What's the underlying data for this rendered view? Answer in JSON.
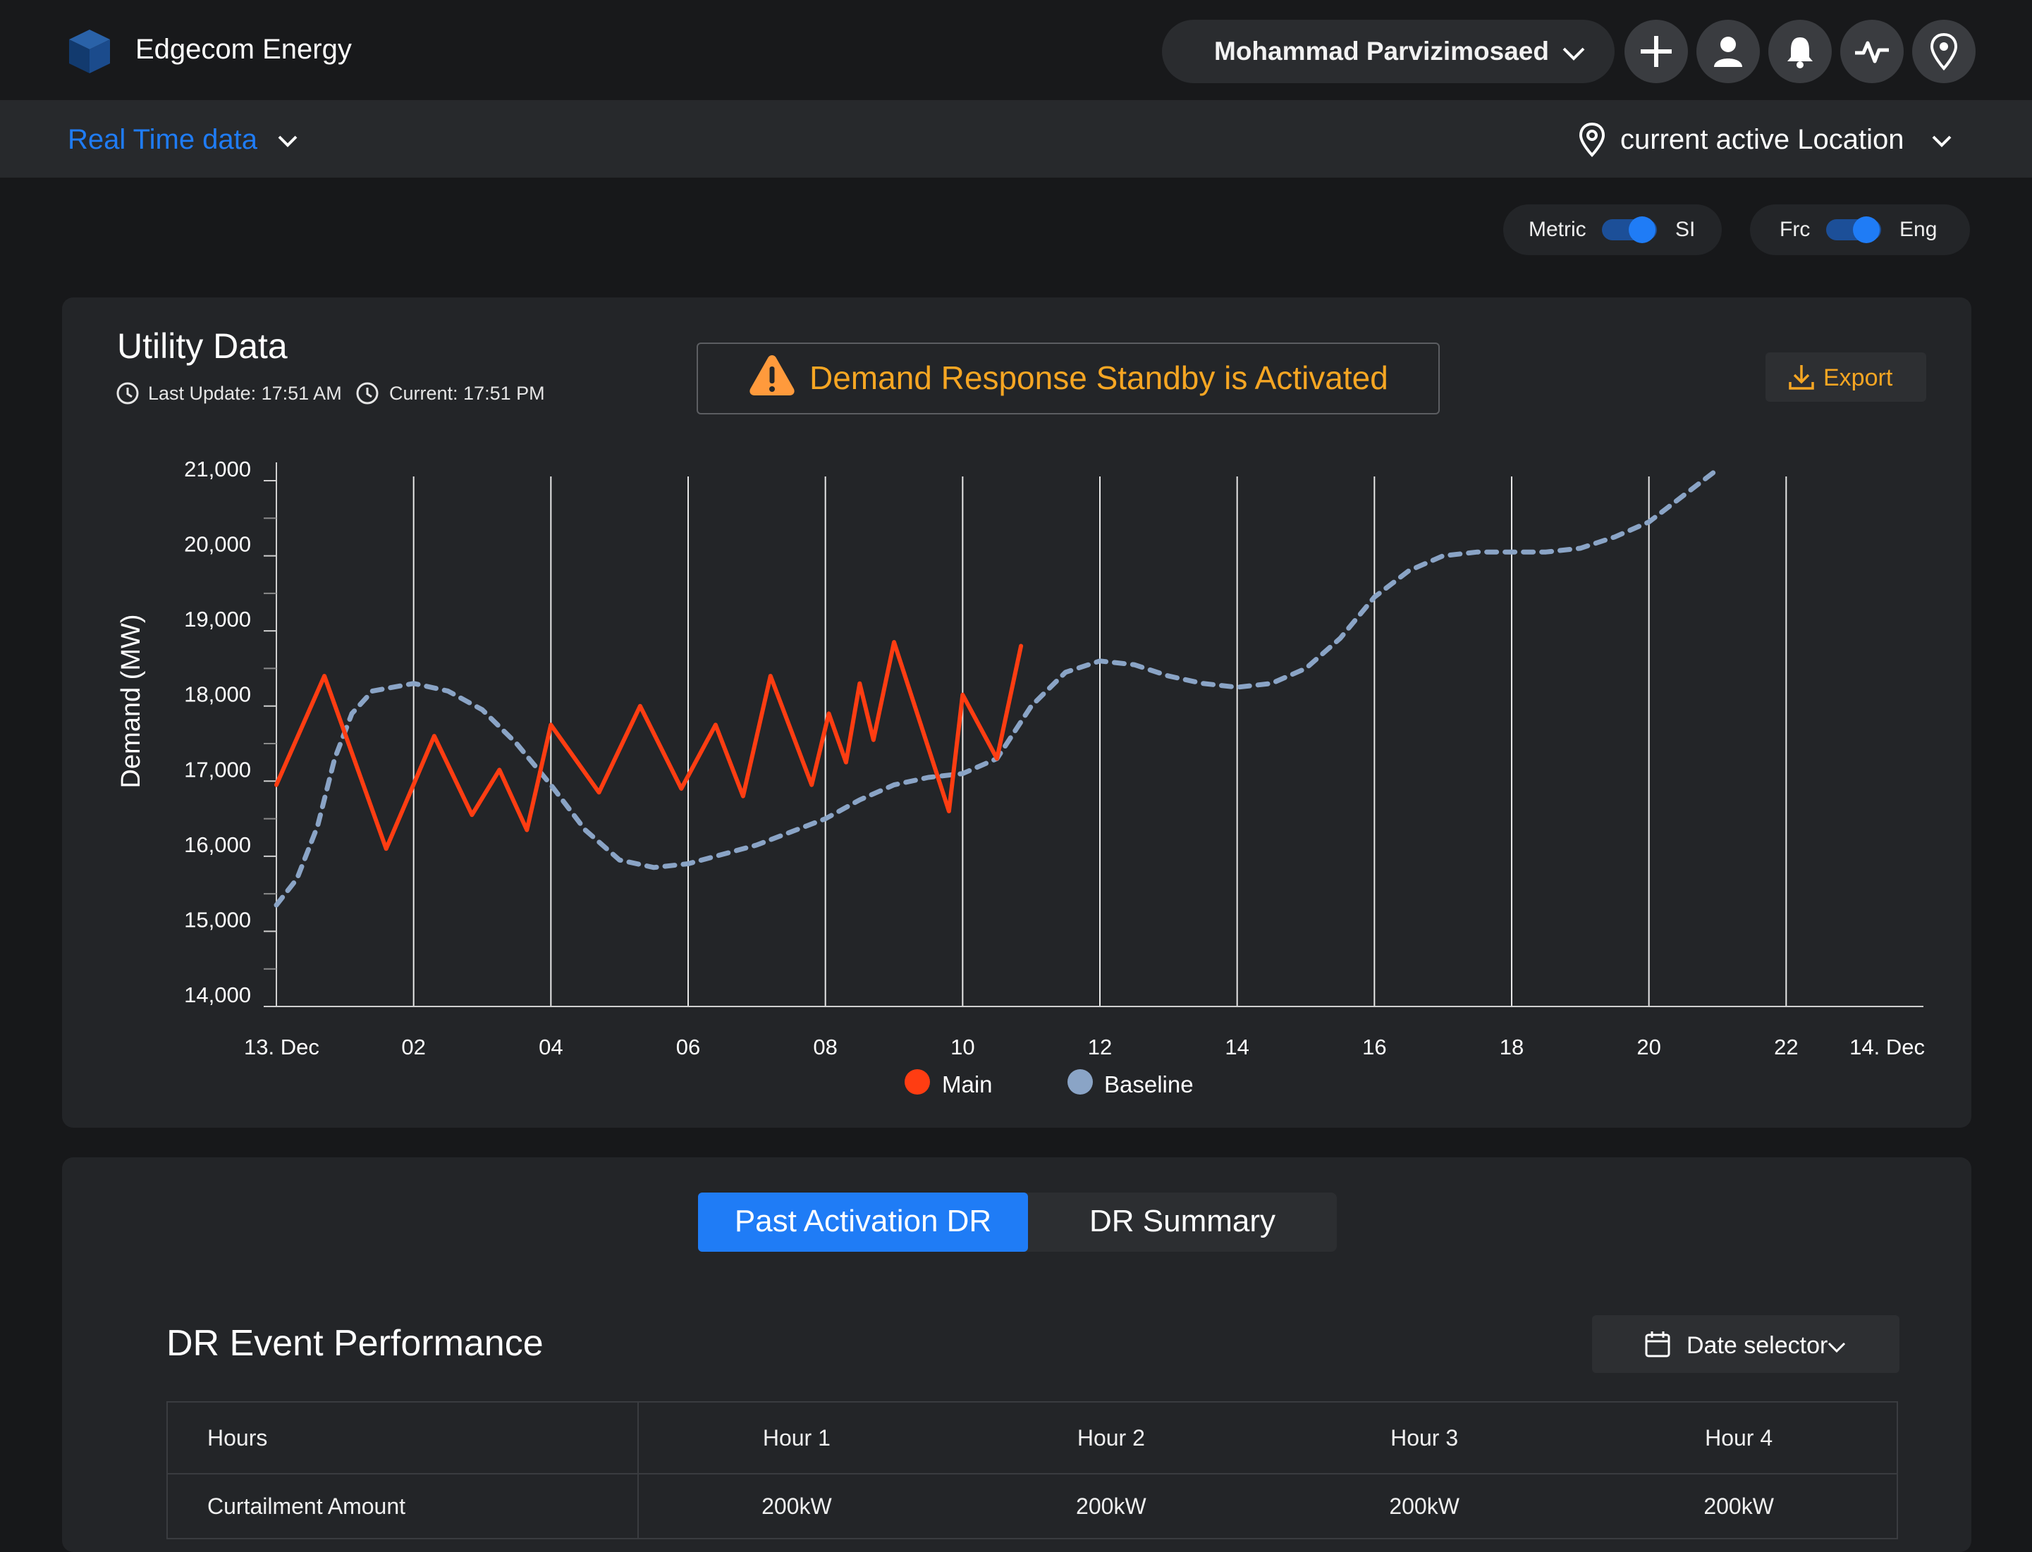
{
  "header": {
    "brand": "Edgecom Energy",
    "user_name": "Mohammad Parvizimosaed",
    "icons": [
      "plus-icon",
      "user-icon",
      "bell-icon",
      "activity-icon",
      "location-pin-icon"
    ]
  },
  "subbar": {
    "view_selector": "Real Time data",
    "location_selector": "current active Location"
  },
  "toggles": {
    "units": {
      "left": "Metric",
      "right": "SI",
      "state": "right"
    },
    "language": {
      "left": "Frc",
      "right": "Eng",
      "state": "right"
    }
  },
  "utility_card": {
    "title": "Utility Data",
    "last_update": "Last Update: 17:51 AM",
    "current": "Current: 17:51 PM",
    "alert": "Demand Response Standby is Activated",
    "export_label": "Export"
  },
  "colors": {
    "accent": "#1f7cf6",
    "warning": "#f6a623",
    "main_series": "#ff3d12",
    "baseline_series": "#8aa4c6",
    "background": "#17181a",
    "card": "#232528"
  },
  "chart_data": {
    "type": "line",
    "ylabel": "Demand (MW)",
    "xlabel": "",
    "ylim": [
      14000,
      21000
    ],
    "y_ticks": [
      "21,000",
      "20,000",
      "19,000",
      "18,000",
      "17,000",
      "16,000",
      "15,000",
      "14,000"
    ],
    "x_range_hours": [
      0,
      24
    ],
    "x_ticks": [
      {
        "hour": 0,
        "label": "13. Dec"
      },
      {
        "hour": 2,
        "label": "02"
      },
      {
        "hour": 4,
        "label": "04"
      },
      {
        "hour": 6,
        "label": "06"
      },
      {
        "hour": 8,
        "label": "08"
      },
      {
        "hour": 10,
        "label": "10"
      },
      {
        "hour": 12,
        "label": "12"
      },
      {
        "hour": 14,
        "label": "14"
      },
      {
        "hour": 16,
        "label": "16"
      },
      {
        "hour": 18,
        "label": "18"
      },
      {
        "hour": 20,
        "label": "20"
      },
      {
        "hour": 22,
        "label": "22"
      },
      {
        "hour": 24,
        "label": "14. Dec"
      }
    ],
    "grid": "vertical",
    "legend_position": "bottom-center",
    "series": [
      {
        "name": "Main",
        "style": "solid",
        "points": [
          [
            0,
            16950
          ],
          [
            0.7,
            18400
          ],
          [
            1.6,
            16100
          ],
          [
            2.3,
            17600
          ],
          [
            2.85,
            16550
          ],
          [
            3.25,
            17150
          ],
          [
            3.65,
            16350
          ],
          [
            4.0,
            17750
          ],
          [
            4.7,
            16850
          ],
          [
            5.3,
            18000
          ],
          [
            5.9,
            16900
          ],
          [
            6.4,
            17750
          ],
          [
            6.8,
            16800
          ],
          [
            7.2,
            18400
          ],
          [
            7.8,
            16950
          ],
          [
            8.05,
            17900
          ],
          [
            8.3,
            17250
          ],
          [
            8.5,
            18300
          ],
          [
            8.7,
            17550
          ],
          [
            9.0,
            18850
          ],
          [
            9.8,
            16600
          ],
          [
            10.0,
            18150
          ],
          [
            10.5,
            17300
          ],
          [
            10.85,
            18800
          ]
        ]
      },
      {
        "name": "Baseline",
        "style": "dashed",
        "points": [
          [
            0,
            15350
          ],
          [
            0.3,
            15700
          ],
          [
            0.6,
            16400
          ],
          [
            0.85,
            17300
          ],
          [
            1.1,
            17900
          ],
          [
            1.4,
            18200
          ],
          [
            2.0,
            18300
          ],
          [
            2.5,
            18200
          ],
          [
            3.0,
            17950
          ],
          [
            3.5,
            17500
          ],
          [
            4.0,
            16950
          ],
          [
            4.5,
            16350
          ],
          [
            5.0,
            15950
          ],
          [
            5.5,
            15850
          ],
          [
            6.0,
            15900
          ],
          [
            7.0,
            16150
          ],
          [
            8.0,
            16500
          ],
          [
            8.5,
            16750
          ],
          [
            9.0,
            16950
          ],
          [
            9.5,
            17050
          ],
          [
            10.0,
            17100
          ],
          [
            10.5,
            17300
          ],
          [
            11.0,
            18000
          ],
          [
            11.5,
            18450
          ],
          [
            12.0,
            18600
          ],
          [
            12.5,
            18550
          ],
          [
            13.0,
            18400
          ],
          [
            13.5,
            18300
          ],
          [
            14.0,
            18250
          ],
          [
            14.5,
            18300
          ],
          [
            15.0,
            18500
          ],
          [
            15.5,
            18900
          ],
          [
            16.0,
            19450
          ],
          [
            16.5,
            19800
          ],
          [
            17.0,
            20000
          ],
          [
            17.5,
            20050
          ],
          [
            18.0,
            20050
          ],
          [
            18.5,
            20050
          ],
          [
            19.0,
            20100
          ],
          [
            19.5,
            20250
          ],
          [
            20.0,
            20450
          ],
          [
            20.5,
            20800
          ],
          [
            21.0,
            21150
          ]
        ]
      }
    ]
  },
  "bottom_card": {
    "tabs": [
      {
        "label": "Past Activation DR",
        "active": true
      },
      {
        "label": "DR Summary",
        "active": false
      }
    ],
    "section_title": "DR Event Performance",
    "date_selector": "Date selector",
    "table": {
      "headers": [
        "Hours",
        "Hour 1",
        "Hour 2",
        "Hour 3",
        "Hour 4"
      ],
      "rows": [
        [
          "Curtailment Amount",
          "200kW",
          "200kW",
          "200kW",
          "200kW"
        ]
      ]
    }
  }
}
